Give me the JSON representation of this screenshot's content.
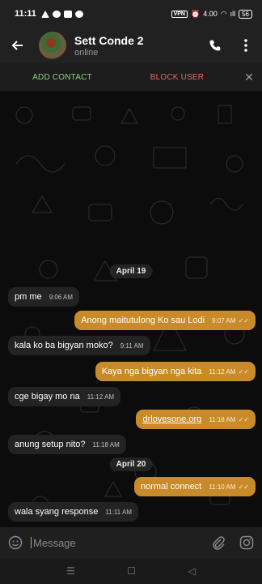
{
  "status_bar": {
    "time": "11:11",
    "vpn": "VPN",
    "network": "4.00",
    "signal_label": "ıll",
    "battery": "56"
  },
  "header": {
    "back_icon": "back-arrow-icon",
    "title": "Sett Conde 2",
    "subtitle": "online",
    "call_icon": "phone-icon",
    "menu_icon": "more-vert-icon"
  },
  "action_bar": {
    "add_contact": "ADD CONTACT",
    "block_user": "BLOCK USER",
    "close": "✕"
  },
  "messages": [
    {
      "type": "date",
      "text": "April 19"
    },
    {
      "type": "in",
      "text": "pm me",
      "time": "9:06 AM"
    },
    {
      "type": "out",
      "text": "Anong maitutulong Ko sau Lodi",
      "time": "9:07 AM"
    },
    {
      "type": "in",
      "text": "kala ko ba bigyan moko?",
      "time": "9:11 AM"
    },
    {
      "type": "out",
      "text": "Kaya nga bigyan nga kita",
      "time": "11:12 AM"
    },
    {
      "type": "in",
      "text": "cge bigay mo na",
      "time": "11:12 AM"
    },
    {
      "type": "out",
      "text": "drlovesone.org",
      "time": "11:18 AM"
    },
    {
      "type": "in",
      "text": "anung setup nito?",
      "time": "11:18 AM"
    },
    {
      "type": "date",
      "text": "April 20"
    },
    {
      "type": "out",
      "text": "normal connect",
      "time": "11:10 AM"
    },
    {
      "type": "in",
      "text": "wala syang response",
      "time": "11:11 AM"
    }
  ],
  "composer": {
    "placeholder": "Message",
    "emoji_icon": "emoji-icon",
    "attach_icon": "paperclip-icon",
    "instagram_icon": "camera-icon"
  },
  "navbar": {
    "menu": "☰",
    "home": "☐",
    "back": "◁"
  },
  "colors": {
    "outgoing": "#c98a2a",
    "incoming": "#232323",
    "add_contact": "#8bd27a",
    "block_user": "#e36a5f"
  }
}
